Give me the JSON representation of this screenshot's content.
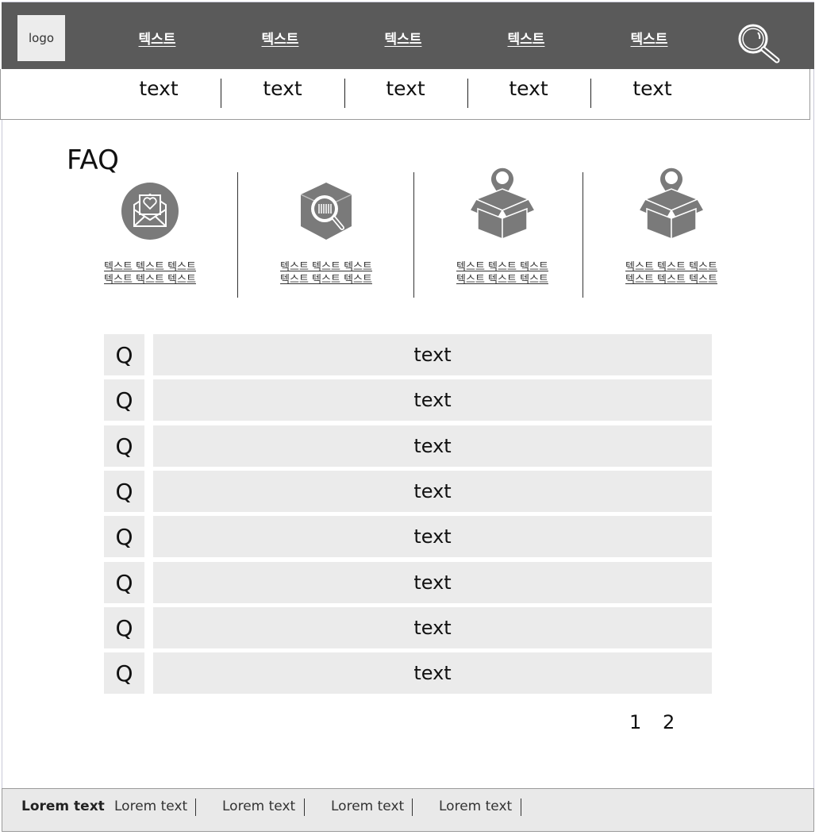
{
  "header": {
    "logo": "logo",
    "nav": [
      "텍스트",
      "텍스트",
      "텍스트",
      "텍스트",
      "텍스트"
    ],
    "search_icon": "search-icon"
  },
  "subnav": [
    "text",
    "text",
    "text",
    "text",
    "text"
  ],
  "faq": {
    "title": "FAQ",
    "categories": [
      {
        "icon": "heart-envelope-icon",
        "line1": "텍스트 텍스트 텍스트",
        "line2": "텍스트 텍스트 텍스트"
      },
      {
        "icon": "barcode-search-box-icon",
        "line1": "텍스트 텍스트 텍스트",
        "line2": "텍스트 텍스트 텍스트"
      },
      {
        "icon": "box-location-pin-icon",
        "line1": "텍스트 텍스트 텍스트",
        "line2": "텍스트 텍스트 텍스트"
      },
      {
        "icon": "box-location-pin-icon",
        "line1": "텍스트 텍스트 텍스트",
        "line2": "텍스트 텍스트 텍스트"
      }
    ],
    "questions": [
      {
        "q": "Q",
        "text": "text"
      },
      {
        "q": "Q",
        "text": "text"
      },
      {
        "q": "Q",
        "text": "text"
      },
      {
        "q": "Q",
        "text": "text"
      },
      {
        "q": "Q",
        "text": "text"
      },
      {
        "q": "Q",
        "text": "text"
      },
      {
        "q": "Q",
        "text": "text"
      },
      {
        "q": "Q",
        "text": "text"
      }
    ]
  },
  "pagination": [
    "1",
    "2"
  ],
  "footer": [
    "Lorem text",
    "Lorem text",
    "Lorem text",
    "Lorem text",
    "Lorem text"
  ],
  "colors": {
    "topnav_bg": "#5a5a5a",
    "row_bg": "#ebebeb",
    "footer_bg": "#e9e9e9",
    "icon": "#7a7a7a"
  }
}
